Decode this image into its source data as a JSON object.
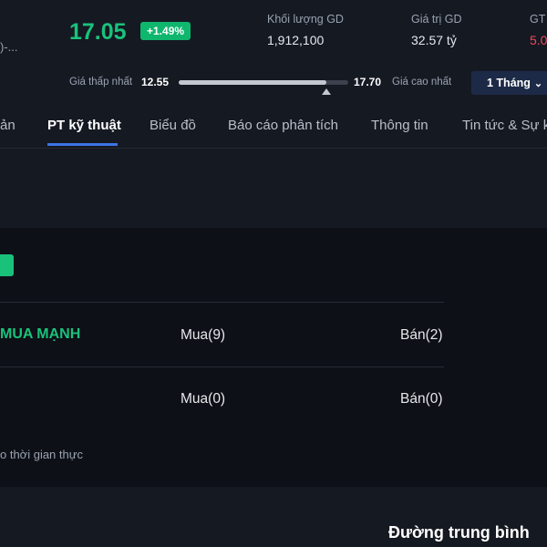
{
  "header": {
    "truncated_text": ")-...",
    "price": "17.05",
    "change": "+1.49%",
    "stats": [
      {
        "label": "Khối lượng GD",
        "value": "1,912,100"
      },
      {
        "label": "Giá trị GD",
        "value": "32.57 tỷ"
      },
      {
        "label": "GT",
        "value": "5.0"
      }
    ]
  },
  "range": {
    "low_label": "Giá thấp nhất",
    "low_value": "12.55",
    "high_value": "17.70",
    "high_label": "Giá cao nhất",
    "position_fraction": 0.87,
    "period": "1 Tháng"
  },
  "tabs": [
    {
      "label": "ản"
    },
    {
      "label": "PT kỹ thuật",
      "active": true
    },
    {
      "label": "Biểu đồ"
    },
    {
      "label": "Báo cáo phân tích"
    },
    {
      "label": "Thông tin"
    },
    {
      "label": "Tin tức & Sự k"
    }
  ],
  "analysis": {
    "rows": [
      {
        "signal": "MUA MẠNH",
        "buy": "Mua(9)",
        "sell": "Bán(2)"
      },
      {
        "signal": "",
        "buy": "Mua(0)",
        "sell": "Bán(0)"
      }
    ],
    "footnote": "o thời gian thực"
  },
  "section_title": "Đường trung bình",
  "colors": {
    "up": "#19c27b",
    "down": "#f0495c",
    "accent": "#3d74e6",
    "background": "#151922",
    "panel": "#0d1016"
  }
}
